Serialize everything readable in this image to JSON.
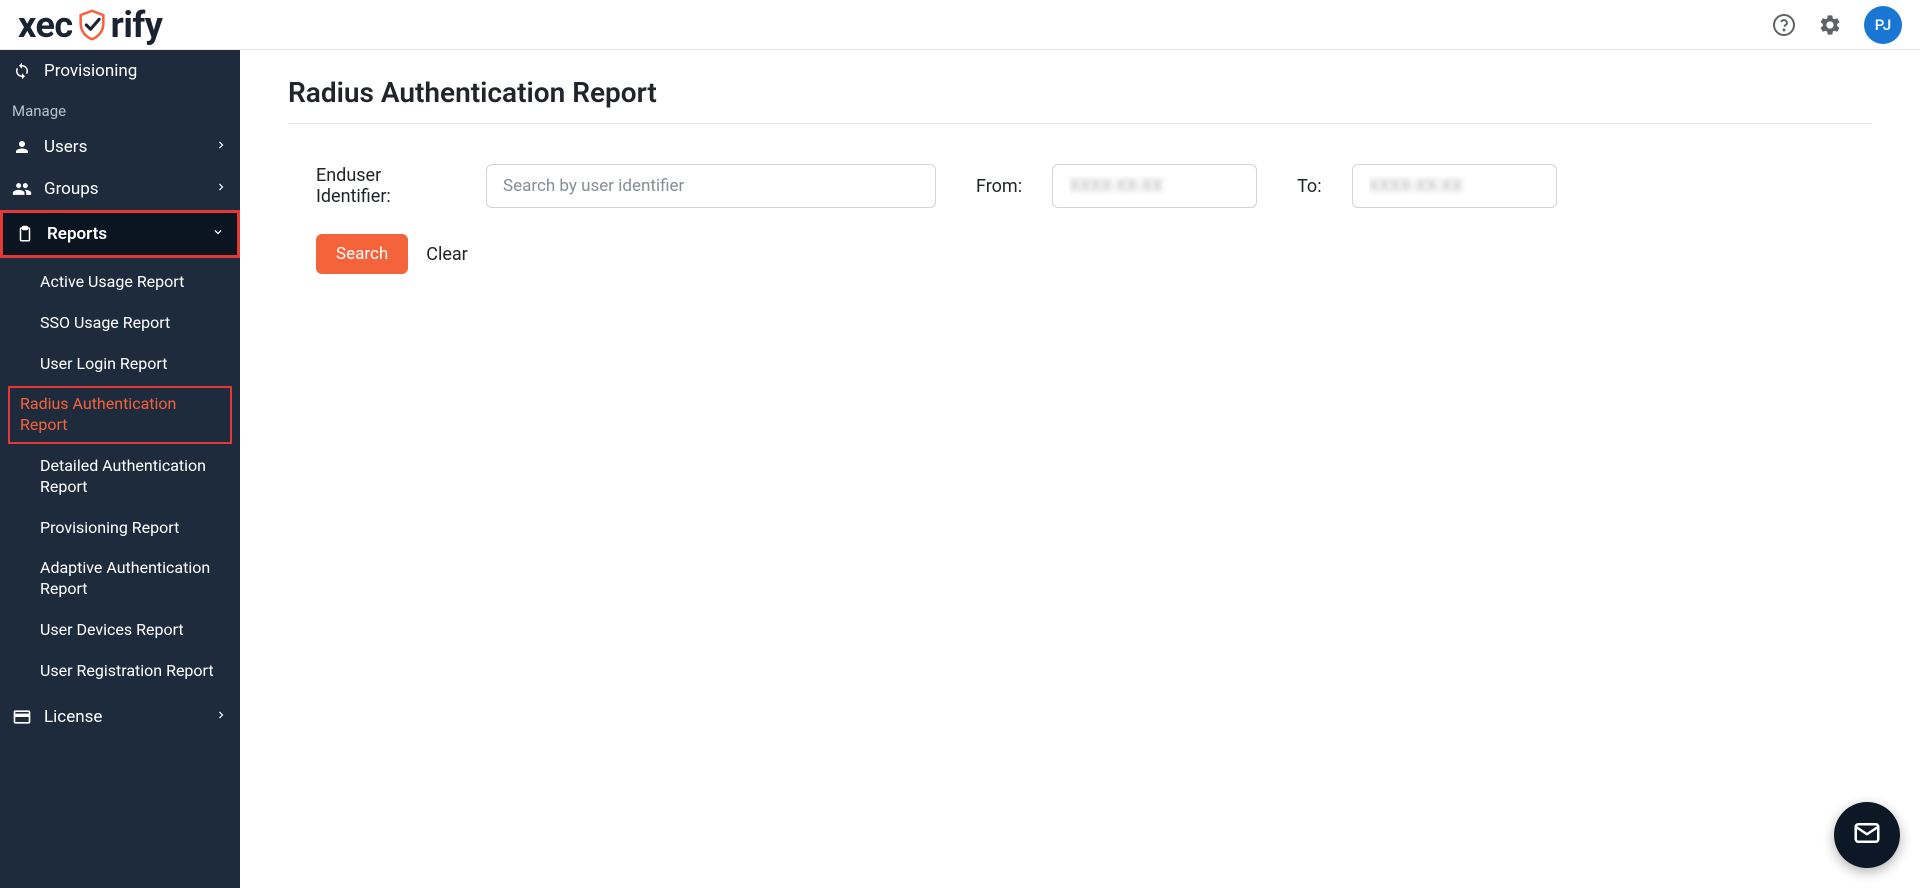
{
  "header": {
    "logo_parts": {
      "pre": "xec",
      "post": "rify"
    },
    "avatar_initials": "PJ"
  },
  "sidebar": {
    "provisioning": "Provisioning",
    "section_manage": "Manage",
    "users": "Users",
    "groups": "Groups",
    "reports": "Reports",
    "report_items": {
      "active_usage": "Active Usage Report",
      "sso_usage": "SSO Usage Report",
      "user_login": "User Login Report",
      "radius_auth": "Radius Authentication Report",
      "detailed_auth": "Detailed Authentication Report",
      "provisioning": "Provisioning Report",
      "adaptive_auth": "Adaptive Authentication Report",
      "user_devices": "User Devices Report",
      "user_registration": "User Registration Report"
    },
    "license": "License"
  },
  "main": {
    "title": "Radius Authentication Report",
    "labels": {
      "enduser": "Enduser Identifier:",
      "from": "From:",
      "to": "To:"
    },
    "placeholders": {
      "identifier": "Search by user identifier",
      "from_date": "XXXX-XX-XX",
      "to_date": "XXXX-XX-XX"
    },
    "buttons": {
      "search": "Search",
      "clear": "Clear"
    }
  }
}
